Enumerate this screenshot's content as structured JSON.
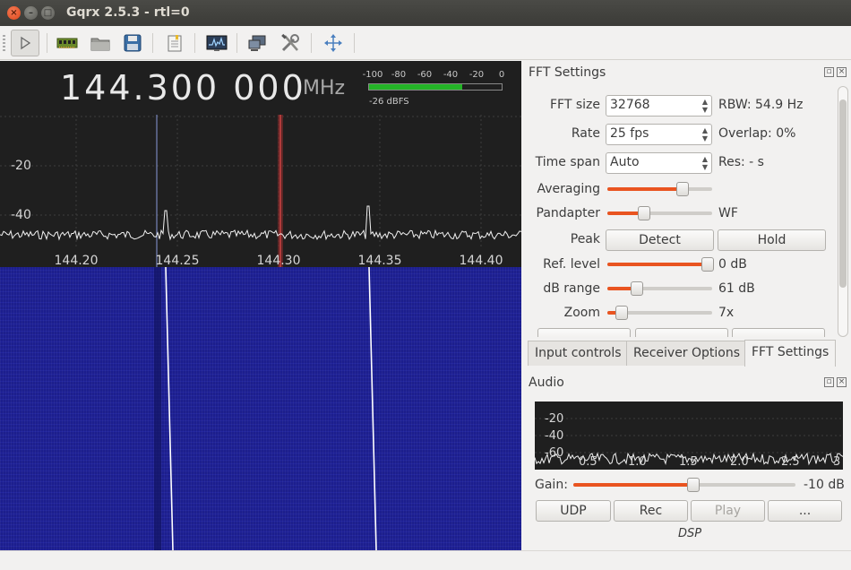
{
  "window": {
    "title": "Gqrx 2.5.3 - rtl=0"
  },
  "toolbar": {
    "items": [
      {
        "name": "start-dsp-button",
        "icon": "play-icon"
      },
      {
        "name": "input-device-button",
        "icon": "hardware-icon"
      },
      {
        "name": "load-settings-button",
        "icon": "folder-icon"
      },
      {
        "name": "save-settings-button",
        "icon": "save-icon"
      },
      {
        "name": "bookmarks-button",
        "icon": "bookmark-icon"
      },
      {
        "name": "fft-dock-button",
        "icon": "spectrum-icon"
      },
      {
        "name": "remote-control-button",
        "icon": "network-icon"
      },
      {
        "name": "tools-button",
        "icon": "tools-icon"
      },
      {
        "name": "fullscreen-button",
        "icon": "fullscreen-icon"
      }
    ]
  },
  "spectrum": {
    "frequency": "144.300 000",
    "unit": "MHz",
    "meter_ticks": [
      "-100",
      "-80",
      "-60",
      "-40",
      "-20",
      "0"
    ],
    "meter_level": 0.7,
    "meter_reading": "-26 dBFS",
    "y_labels": [
      "-20",
      "-40"
    ],
    "x_labels": [
      "144.20",
      "144.25",
      "144.30",
      "144.35",
      "144.40"
    ]
  },
  "fft_settings": {
    "title": "FFT Settings",
    "fft_size_label": "FFT size",
    "fft_size_value": "32768",
    "rbw": "RBW: 54.9 Hz",
    "rate_label": "Rate",
    "rate_value": "25 fps",
    "overlap": "Overlap: 0%",
    "timespan_label": "Time span",
    "timespan_value": "Auto",
    "res": "Res: - s",
    "averaging_label": "Averaging",
    "averaging_level": 0.72,
    "pandapter_label": "Pandapter",
    "pandapter_level": 0.35,
    "wf_label": "WF",
    "peak_label": "Peak",
    "detect_label": "Detect",
    "hold_label": "Hold",
    "ref_level_label": "Ref. level",
    "ref_level_value": "0 dB",
    "ref_level_level": 0.96,
    "db_range_label": "dB range",
    "db_range_value": "61 dB",
    "db_range_level": 0.28,
    "zoom_label": "Zoom",
    "zoom_value": "7x",
    "zoom_level": 0.14
  },
  "tabs": [
    {
      "label": "Input controls",
      "active": false
    },
    {
      "label": "Receiver Options",
      "active": false
    },
    {
      "label": "FFT Settings",
      "active": true
    }
  ],
  "audio": {
    "title": "Audio",
    "y_labels": [
      "-20",
      "-40",
      "-60"
    ],
    "x_labels": [
      "0.5",
      "1.0",
      "1.5",
      "2.0",
      "2.5",
      "3"
    ],
    "gain_label": "Gain:",
    "gain_value": "-10 dB",
    "gain_level": 0.54,
    "udp_label": "UDP",
    "rec_label": "Rec",
    "play_label": "Play",
    "more_label": "...",
    "dsp_label": "DSP"
  },
  "colors": {
    "accent": "#e95420",
    "meter": "#24b327",
    "waterfall": "#1c1e8e"
  }
}
